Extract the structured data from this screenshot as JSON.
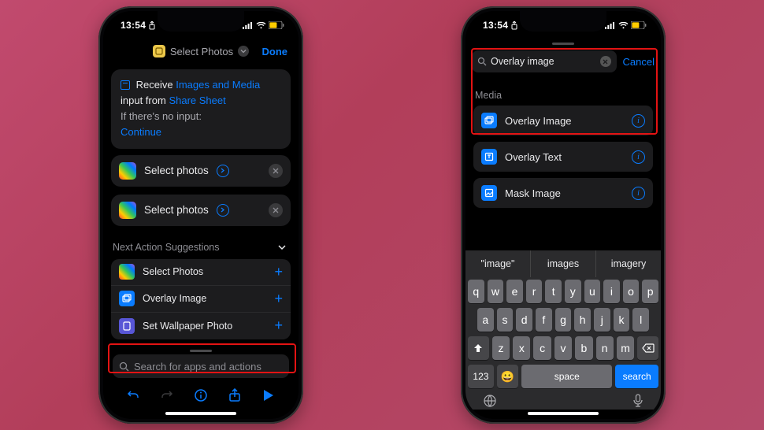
{
  "status": {
    "time": "13:54",
    "share_icon": "share",
    "signal": "sig",
    "wifi": "wifi",
    "battery": "58"
  },
  "phone1": {
    "header": {
      "title": "Select Photos",
      "done": "Done"
    },
    "receive_card": {
      "receive_label": "Receive",
      "images_media": "Images and Media",
      "input_from": "input from",
      "share_sheet": "Share Sheet",
      "no_input_label": "If there's no input:",
      "continue": "Continue"
    },
    "actions": [
      {
        "label": "Select photos"
      },
      {
        "label": "Select photos"
      }
    ],
    "suggestions_label": "Next Action Suggestions",
    "suggestions": [
      {
        "label": "Select Photos",
        "icon": "photos"
      },
      {
        "label": "Overlay Image",
        "icon": "overlay"
      },
      {
        "label": "Set Wallpaper Photo",
        "icon": "wallpaper"
      }
    ],
    "search_placeholder": "Search for apps and actions"
  },
  "phone2": {
    "search_value": "Overlay image",
    "cancel": "Cancel",
    "category": "Media",
    "results": [
      {
        "label": "Overlay Image"
      },
      {
        "label": "Overlay Text"
      },
      {
        "label": "Mask Image"
      }
    ],
    "predictions": [
      "\"image\"",
      "images",
      "imagery"
    ],
    "kb": {
      "row1": [
        "q",
        "w",
        "e",
        "r",
        "t",
        "y",
        "u",
        "i",
        "o",
        "p"
      ],
      "row2": [
        "a",
        "s",
        "d",
        "f",
        "g",
        "h",
        "j",
        "k",
        "l"
      ],
      "row3": [
        "z",
        "x",
        "c",
        "v",
        "b",
        "n",
        "m"
      ],
      "k123": "123",
      "space": "space",
      "search": "search"
    }
  }
}
